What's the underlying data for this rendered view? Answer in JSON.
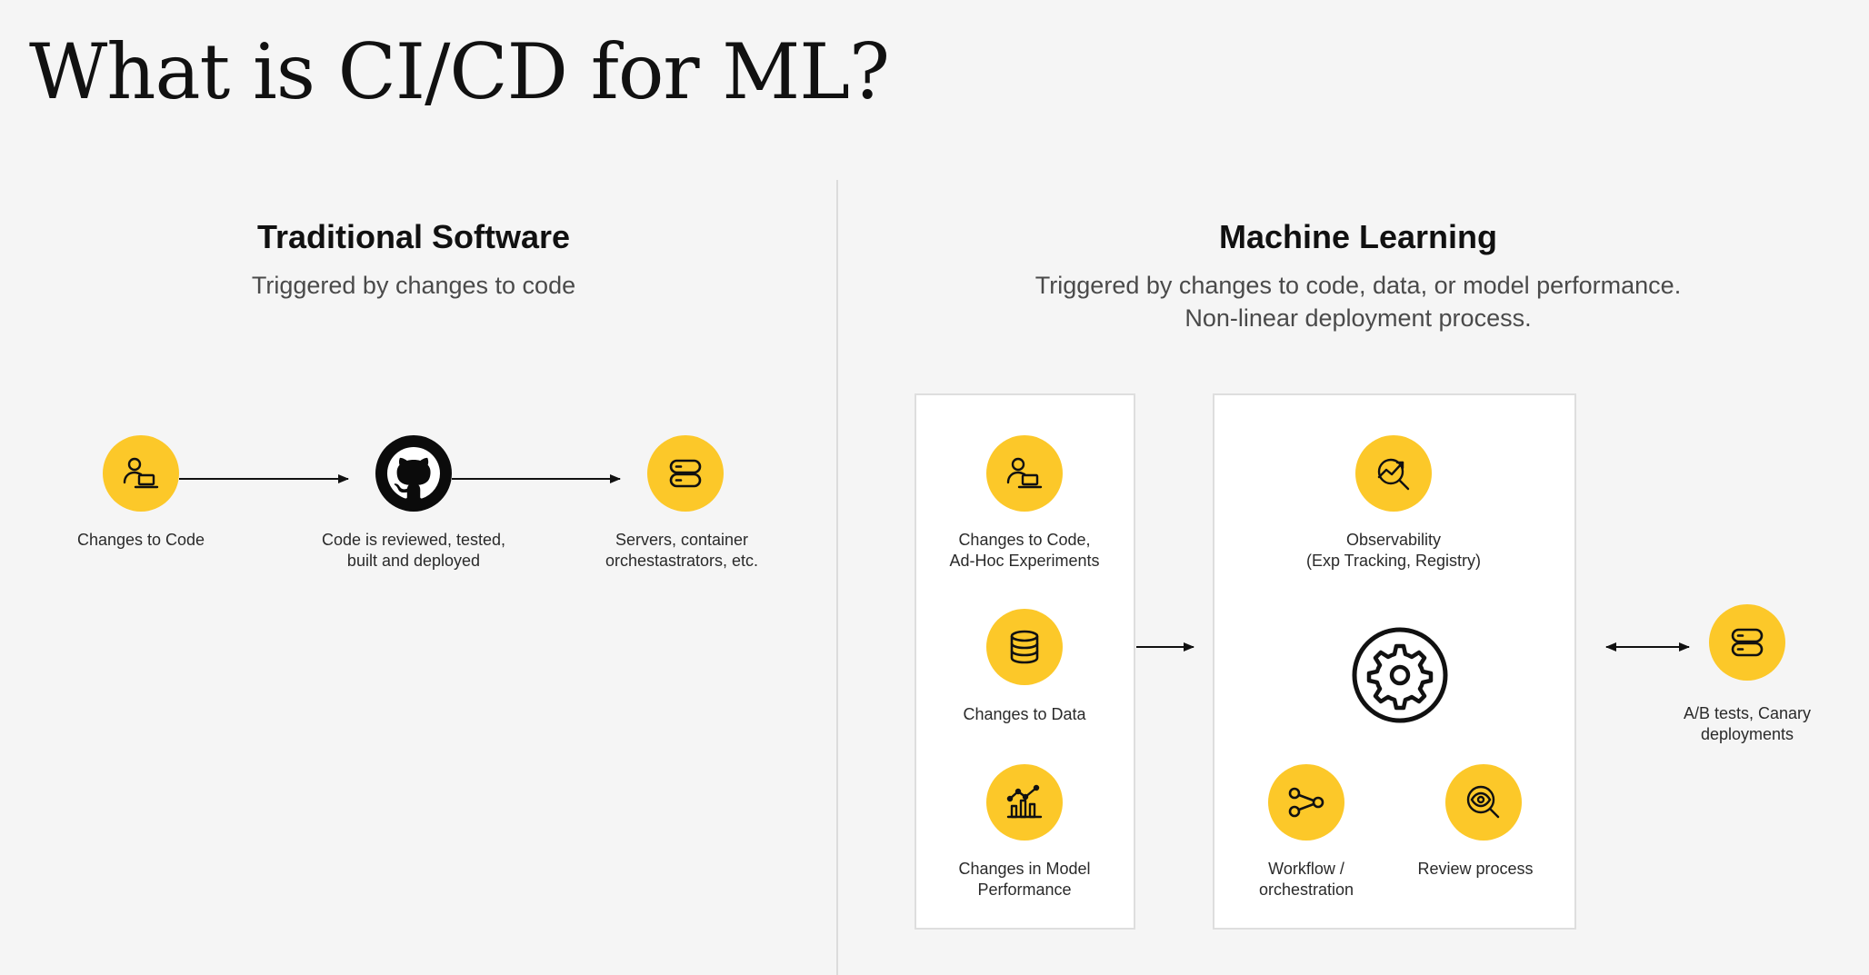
{
  "slide": {
    "title": "What is CI/CD for ML?"
  },
  "traditional": {
    "title": "Traditional Software",
    "subtitle": "Triggered by changes to code",
    "nodes": [
      {
        "icon": "person-laptop-icon",
        "lines": [
          "Changes to Code"
        ]
      },
      {
        "icon": "github-icon",
        "lines": [
          "Code is reviewed, tested,",
          "built and deployed"
        ]
      },
      {
        "icon": "server-icon",
        "lines": [
          "Servers, container",
          "orchestastrators, etc."
        ]
      }
    ]
  },
  "ml": {
    "title": "Machine Learning",
    "subtitle_lines": [
      "Triggered by changes to code, data, or model performance.",
      "Non-linear deployment process."
    ],
    "triggers": [
      {
        "icon": "person-laptop-icon",
        "lines": [
          "Changes to Code,",
          "Ad-Hoc Experiments"
        ]
      },
      {
        "icon": "database-icon",
        "lines": [
          "Changes to Data"
        ]
      },
      {
        "icon": "performance-chart-icon",
        "lines": [
          "Changes in Model",
          "Performance"
        ]
      }
    ],
    "pipeline": [
      {
        "icon": "observability-chart-icon",
        "lines": [
          "Observability",
          "(Exp Tracking, Registry)"
        ]
      },
      {
        "icon": "gear-icon",
        "lines": []
      },
      {
        "icon": "workflow-share-icon",
        "lines": [
          "Workflow /",
          "orchestration"
        ]
      },
      {
        "icon": "review-eye-icon",
        "lines": [
          "Review process"
        ]
      }
    ],
    "deployment": {
      "icon": "server-icon",
      "lines": [
        "A/B tests, Canary",
        "deployments"
      ]
    }
  },
  "colors": {
    "accent": "#fcc829",
    "background": "#f5f5f5",
    "panel": "#ffffff",
    "icon_dark": "#0b0b0b"
  }
}
